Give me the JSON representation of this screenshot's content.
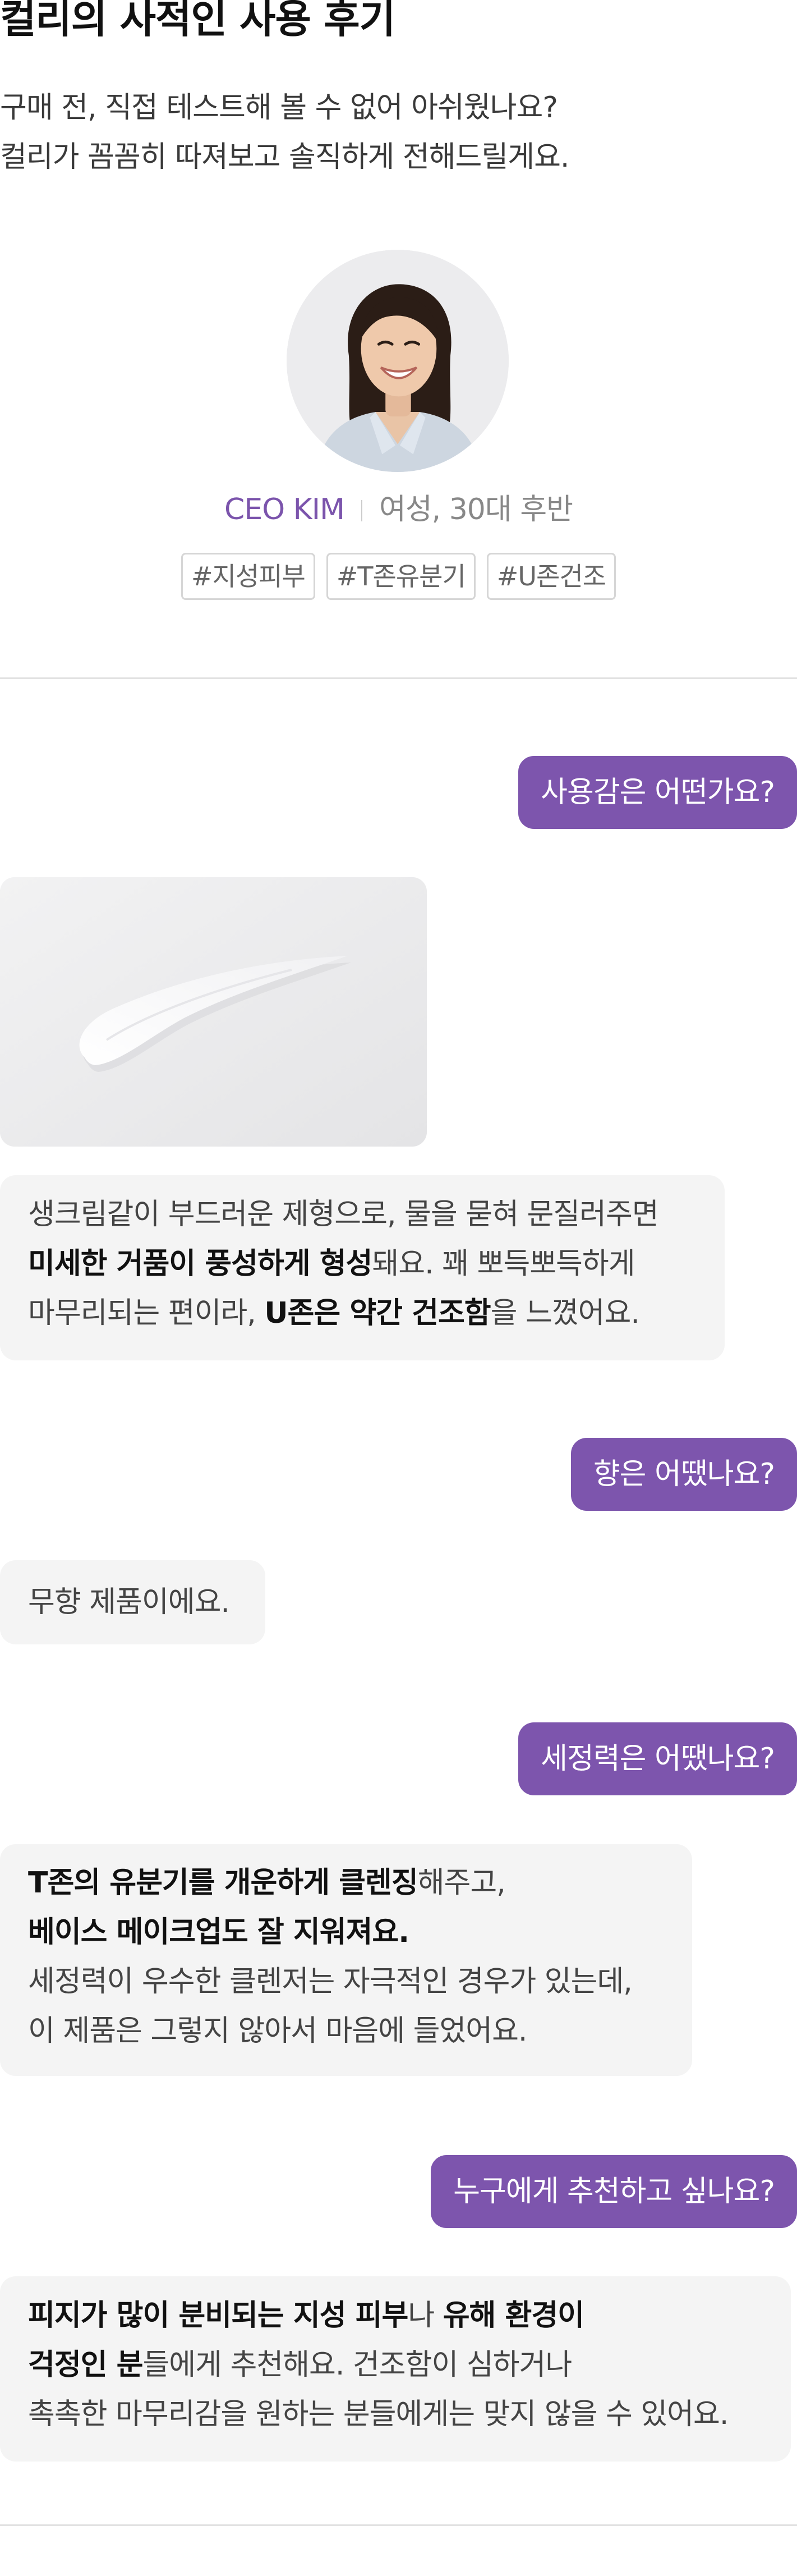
{
  "review": {
    "title": "컬리의 사적인 사용 후기",
    "intro": [
      "구매 전, 직접 테스트해 볼 수 없어 아쉬웠나요?",
      "컬리가 꼼꼼히 따져보고 솔직하게 전해드릴게요."
    ]
  },
  "profile": {
    "name": "CEO KIM",
    "description": "여성, 30대 후반",
    "tags": [
      "#지성피부",
      "#T존유분기",
      "#U존건조"
    ]
  },
  "qa": [
    {
      "question": "사용감은 어떤가요?",
      "answer_lines": [
        [
          {
            "t": "생크림같이 부드러운 제형으로, 물을 묻혀 문질러주면",
            "b": false
          }
        ],
        [
          {
            "t": "미세한 거품이 풍성하게 형성",
            "b": true
          },
          {
            "t": "돼요. 꽤 뽀득뽀득하게",
            "b": false
          }
        ],
        [
          {
            "t": "마무리되는 편이라, ",
            "b": false
          },
          {
            "t": "U존은 약간 건조함",
            "b": true
          },
          {
            "t": "을 느꼈어요.",
            "b": false
          }
        ]
      ]
    },
    {
      "question": "향은 어땠나요?",
      "answer_lines": [
        [
          {
            "t": "무향 제품이에요.",
            "b": false
          }
        ]
      ]
    },
    {
      "question": "세정력은 어땠나요?",
      "answer_lines": [
        [
          {
            "t": "T존의 유분기를 개운하게 클렌징",
            "b": true
          },
          {
            "t": "해주고,",
            "b": false
          }
        ],
        [
          {
            "t": "베이스 메이크업도 잘 지워져요.",
            "b": true
          }
        ],
        [
          {
            "t": "세정력이 우수한 클렌저는 자극적인 경우가 있는데,",
            "b": false
          }
        ],
        [
          {
            "t": "이 제품은 그렇지 않아서 마음에 들었어요.",
            "b": false
          }
        ]
      ]
    },
    {
      "question": "누구에게 추천하고 싶나요?",
      "answer_lines": [
        [
          {
            "t": "피지가 많이 분비되는 지성 피부",
            "b": true
          },
          {
            "t": "나 ",
            "b": false
          },
          {
            "t": "유해 환경이",
            "b": true
          }
        ],
        [
          {
            "t": "걱정인 분",
            "b": true
          },
          {
            "t": "들에게 추천해요. 건조함이 심하거나",
            "b": false
          }
        ],
        [
          {
            "t": "촉촉한 마무리감을 원하는 분들에게는 맞지 않을 수 있어요.",
            "b": false
          }
        ]
      ]
    }
  ],
  "colors": {
    "accent": "#7d55ad",
    "answer_bg": "#f4f4f4"
  },
  "icons": {
    "avatar": "person-portrait",
    "product": "cream-swatch-image"
  }
}
